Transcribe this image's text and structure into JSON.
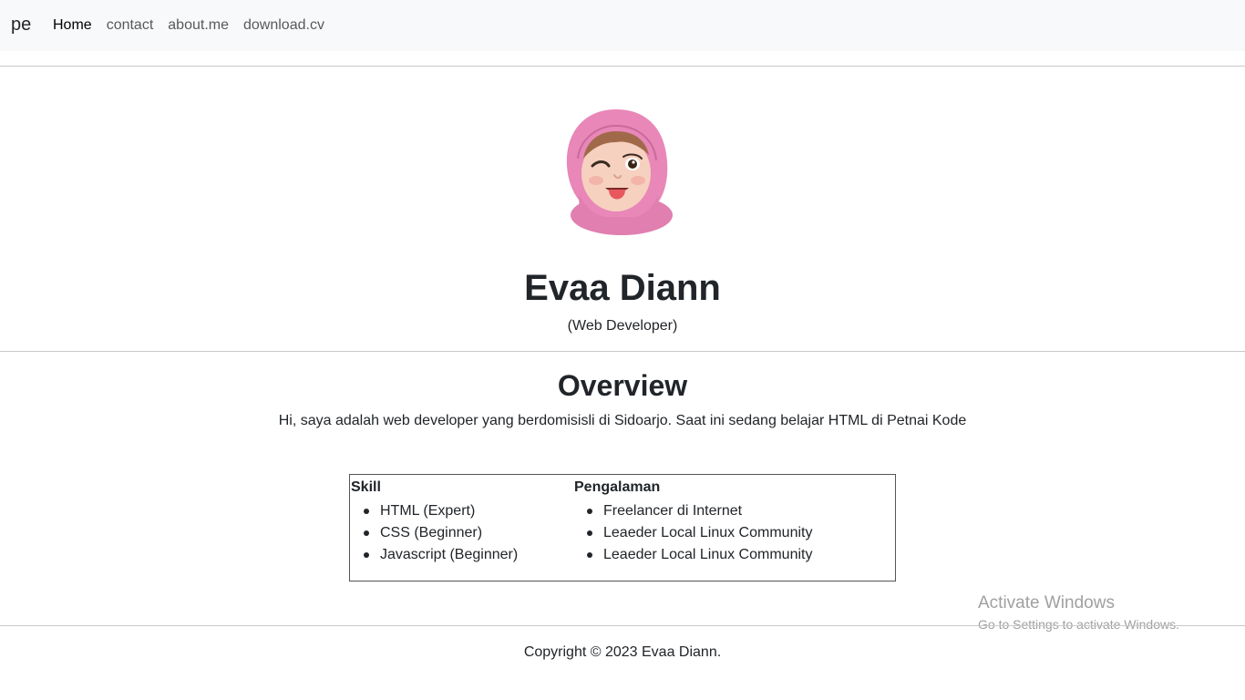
{
  "nav": {
    "brand": "pe",
    "links": [
      "Home",
      "contact",
      "about.me",
      "download.cv"
    ]
  },
  "profile": {
    "name": "Evaa Diann",
    "role": "(Web Developer)",
    "avatar_icon": "memoji-avatar-icon"
  },
  "overview": {
    "title": "Overview",
    "text": "Hi, saya adalah web developer yang berdomisisli di Sidoarjo. Saat ini sedang belajar HTML di Petnai Kode"
  },
  "skills": {
    "title": "Skill",
    "items": [
      "HTML (Expert)",
      "CSS (Beginner)",
      "Javascript (Beginner)"
    ]
  },
  "experience": {
    "title": "Pengalaman",
    "items": [
      "Freelancer di Internet",
      "Leaeder Local Linux Community",
      "Leaeder Local Linux Community"
    ]
  },
  "watermark": {
    "title": "Activate Windows",
    "subtitle": "Go to Settings to activate Windows."
  },
  "footer": {
    "copyright": "Copyright © 2023 Evaa Diann."
  },
  "colors": {
    "navbar_bg": "#f8f9fa",
    "text": "#212529",
    "hijab_pink": "#e887b8"
  }
}
